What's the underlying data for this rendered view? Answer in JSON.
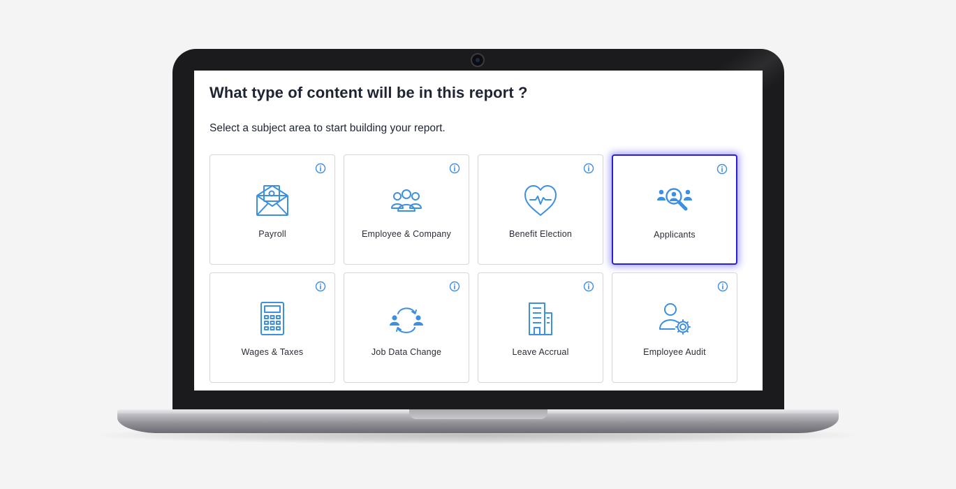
{
  "page": {
    "title": "What type of content will be in this report ?",
    "subtitle": "Select a subject area to start building your report."
  },
  "tiles": [
    {
      "label": "Payroll",
      "icon": "envelope-payslip-icon",
      "selected": false
    },
    {
      "label": "Employee & Company",
      "icon": "people-group-icon",
      "selected": false
    },
    {
      "label": "Benefit Election",
      "icon": "heart-pulse-icon",
      "selected": false
    },
    {
      "label": "Applicants",
      "icon": "applicant-search-icon",
      "selected": true
    },
    {
      "label": "Wages & Taxes",
      "icon": "calculator-icon",
      "selected": false
    },
    {
      "label": "Job Data Change",
      "icon": "people-exchange-icon",
      "selected": false
    },
    {
      "label": "Leave Accrual",
      "icon": "office-building-icon",
      "selected": false
    },
    {
      "label": "Employee Audit",
      "icon": "user-gear-icon",
      "selected": false
    }
  ],
  "colors": {
    "icon_blue": "#3d8fe0",
    "selected_border": "#2a1fd8",
    "title_text": "#1f2433"
  }
}
